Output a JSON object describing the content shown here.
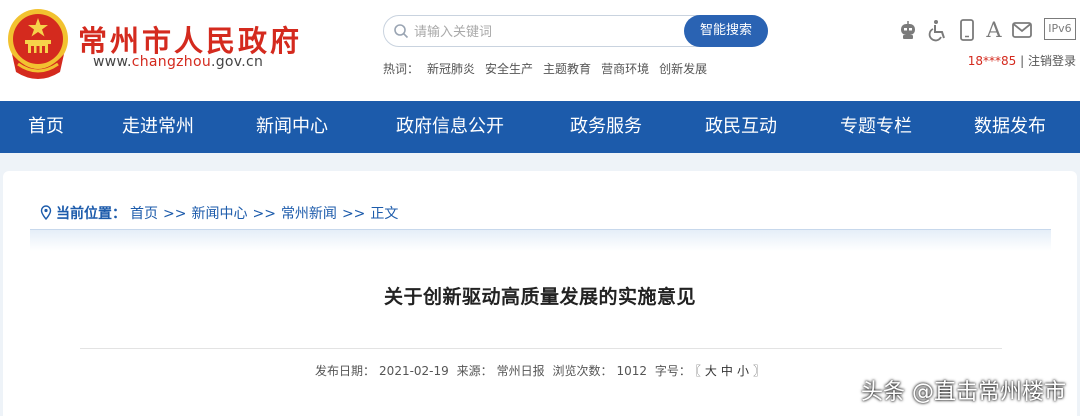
{
  "header": {
    "title": "常州市人民政府",
    "url_prefix": "www.",
    "url_highlight": "changzhou",
    "url_suffix": ".gov.cn",
    "emblem_icon": "national-emblem-icon"
  },
  "search": {
    "placeholder": "请输入关键词",
    "button_label": "智能搜索"
  },
  "hot": {
    "label": "热词：",
    "items": [
      "新冠肺炎",
      "安全生产",
      "主题教育",
      "营商环境",
      "创新发展"
    ]
  },
  "tools": {
    "icons": [
      "robot-icon",
      "accessibility-icon",
      "mobile-icon",
      "font-size-icon",
      "mail-icon",
      "ipv6-icon"
    ],
    "ipv6_label": "IPv6",
    "font_label": "A"
  },
  "user": {
    "name": "18***85",
    "divider": "|",
    "logout_label": "注销登录"
  },
  "nav": {
    "items": [
      "首页",
      "走进常州",
      "新闻中心",
      "政府信息公开",
      "政务服务",
      "政民互动",
      "专题专栏",
      "数据发布"
    ]
  },
  "breadcrumb": {
    "label": "当前位置：",
    "items": [
      "首页",
      "新闻中心",
      "常州新闻",
      "正文"
    ],
    "separator": ">>"
  },
  "article": {
    "title": "关于创新驱动高质量发展的实施意见",
    "publish_date_label": "发布日期：",
    "publish_date": "2021-02-19",
    "source_label": "来源：",
    "source": "常州日报",
    "views_label": "浏览次数：",
    "views": "1012",
    "font_size_label": "字号：",
    "font_size_open": "〖",
    "font_large": "大",
    "font_medium": "中",
    "font_small": "小",
    "font_size_close": "〗"
  },
  "watermark": "头条 @直击常州楼市",
  "colors": {
    "brand_red": "#d42a1e",
    "nav_blue": "#1c5bab",
    "button_blue": "#2a63b3"
  }
}
